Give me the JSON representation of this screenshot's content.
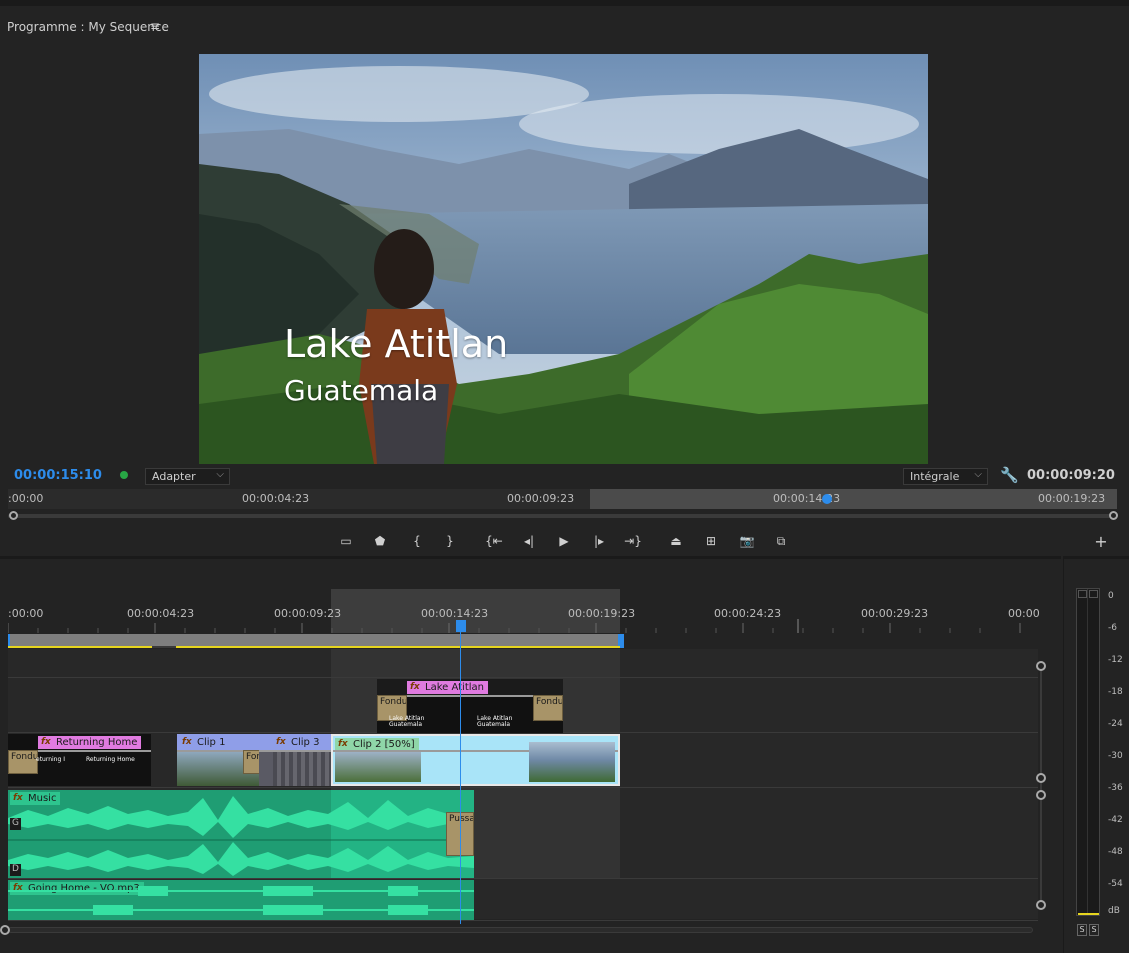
{
  "program_monitor": {
    "title": "Programme : My Sequence",
    "menu_icon": "hamburger-icon",
    "overlay_title": "Lake Atitlan",
    "overlay_subtitle": "Guatemala",
    "current_timecode": "00:00:15:10",
    "fit_select": "Adapter",
    "quality_select": "Intégrale",
    "duration_timecode": "00:00:09:20",
    "ruler_labels": [
      ":00:00",
      "00:00:04:23",
      "00:00:09:23",
      "00:00:14:23",
      "00:00:19:23"
    ],
    "transport_icons": [
      "safe-margins-icon",
      "marker-icon",
      "mark-in-icon",
      "mark-out-icon",
      "go-to-in-icon",
      "step-back-icon",
      "play-icon",
      "step-forward-icon",
      "go-to-out-icon",
      "lift-icon",
      "extract-icon",
      "export-frame-icon",
      "compare-icon"
    ],
    "add_button": "+"
  },
  "timeline": {
    "ruler_labels": [
      ":00:00",
      "00:00:04:23",
      "00:00:09:23",
      "00:00:14:23",
      "00:00:19:23",
      "00:00:24:23",
      "00:00:29:23",
      "00:00"
    ],
    "clips": {
      "title_clip": "Lake Atitlan",
      "title_thumb_1": "Lake Atitlan",
      "title_thumb_1_sub": "Guatemala",
      "title_thumb_2": "Lake Atitlan",
      "title_thumb_2_sub": "Guatemala",
      "returning_home": "Returning Home",
      "returning_home_thumb_1": "eturning I",
      "returning_home_thumb_2": "Returning Home",
      "clip1": "Clip 1",
      "clip3": "Clip 3",
      "clip2": "Clip 2 [50%]",
      "music": "Music",
      "voiceover": "Going Home - VO.mp3"
    },
    "transitions": {
      "fondu": "Fondu",
      "fondu_e": "Fondu e",
      "pussa": "Pussa"
    },
    "channel_labels": {
      "left": "G",
      "right": "D"
    }
  },
  "audio_meter": {
    "db_labels": [
      "0",
      "-6",
      "-12",
      "-18",
      "-24",
      "-30",
      "-36",
      "-42",
      "-48",
      "-54",
      "dB"
    ],
    "solo_buttons": [
      "S",
      "S"
    ]
  },
  "colors": {
    "accent": "#2d8ceb",
    "title_clip": "#e07be0",
    "video_clip": "#8f9ee8",
    "audio_clip": "#1f9d73",
    "yellow_bar": "#e6d51f"
  }
}
